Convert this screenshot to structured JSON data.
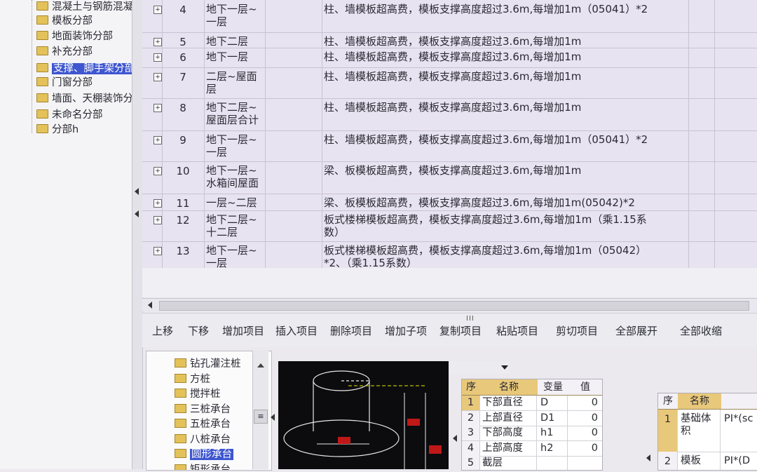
{
  "left_tree": {
    "items": [
      {
        "label": "混凝土与钢筋混凝",
        "selected": false
      },
      {
        "label": "模板分部",
        "selected": false
      },
      {
        "label": "地面装饰分部",
        "selected": false
      },
      {
        "label": "补充分部",
        "selected": false
      },
      {
        "label": "支撑、脚手架分部",
        "selected": true
      },
      {
        "label": "门窗分部",
        "selected": false
      },
      {
        "label": "墙面、天棚装饰分",
        "selected": false
      },
      {
        "label": "未命名分部",
        "selected": false
      },
      {
        "label": "分部h",
        "selected": false
      }
    ]
  },
  "grid": {
    "expand_glyph": "+",
    "rows": [
      {
        "no": "4",
        "position": [
          "地下一层~",
          "一层"
        ],
        "desc": [
          "柱、墙模板超高费，模板支撑高度超过3.6m,每增加1m（05041）*2"
        ]
      },
      {
        "no": "5",
        "position": [
          "地下二层"
        ],
        "desc": [
          "柱、墙模板超高费，模板支撑高度超过3.6m,每增加1m"
        ]
      },
      {
        "no": "6",
        "position": [
          "地下一层"
        ],
        "desc": [
          "柱、墙模板超高费，模板支撑高度超过3.6m,每增加1m"
        ]
      },
      {
        "no": "7",
        "position": [
          "二层~屋面",
          "层"
        ],
        "desc": [
          "柱、墙模板超高费，模板支撑高度超过3.6m,每增加1m"
        ]
      },
      {
        "no": "8",
        "position": [
          "地下二层~",
          "屋面层合计"
        ],
        "desc": [
          "柱、墙模板超高费，模板支撑高度超过3.6m,每增加1m"
        ]
      },
      {
        "no": "9",
        "position": [
          "地下一层~",
          "一层"
        ],
        "desc": [
          "柱、墙模板超高费，模板支撑高度超过3.6m,每增加1m（05041）*2"
        ]
      },
      {
        "no": "10",
        "position": [
          "地下一层~",
          "水箱间屋面"
        ],
        "desc": [
          "梁、板模板超高费，模板支撑高度超过3.6m,每增加1m"
        ]
      },
      {
        "no": "11",
        "position": [
          "一层~二层"
        ],
        "desc": [
          "梁、板模板超高费，模板支撑高度超过3.6m,每增加1m(05042)*2"
        ]
      },
      {
        "no": "12",
        "position": [
          "地下二层~",
          "十二层"
        ],
        "desc": [
          "板式楼梯模板超高费，模板支撑高度超过3.6m,每增加1m（乘1.15系",
          "数）"
        ]
      },
      {
        "no": "13",
        "position": [
          "地下一层~",
          "一层"
        ],
        "desc": [
          "板式楼梯模板超高费，模板支撑高度超过3.6m,每增加1m（05042）",
          "*2、（乘1.15系数）"
        ]
      }
    ]
  },
  "hscroll": {
    "grip": "III"
  },
  "toolbar": {
    "move_up": "上移",
    "move_down": "下移",
    "add_item": "增加项目",
    "insert_item": "插入项目",
    "delete_item": "删除项目",
    "add_child": "增加子项",
    "copy_item": "复制项目",
    "paste_item": "粘贴项目",
    "cut_item": "剪切项目",
    "expand_all": "全部展开",
    "collapse_all": "全部收缩"
  },
  "bottom_tree": {
    "items": [
      {
        "label": "钻孔灌注桩",
        "selected": false
      },
      {
        "label": "方桩",
        "selected": false
      },
      {
        "label": "搅拌桩",
        "selected": false
      },
      {
        "label": "三桩承台",
        "selected": false
      },
      {
        "label": "五桩承台",
        "selected": false
      },
      {
        "label": "八桩承台",
        "selected": false
      },
      {
        "label": "圆形承台",
        "selected": true
      },
      {
        "label": "矩形承台",
        "selected": false
      }
    ]
  },
  "params": {
    "headers": {
      "seq": "序",
      "name": "名称",
      "var": "变量",
      "val": "值"
    },
    "rows": [
      {
        "seq": "1",
        "name": "下部直径",
        "var": "D",
        "val": "0"
      },
      {
        "seq": "2",
        "name": "上部直径",
        "var": "D1",
        "val": "0"
      },
      {
        "seq": "3",
        "name": "下部高度",
        "var": "h1",
        "val": "0"
      },
      {
        "seq": "4",
        "name": "上部高度",
        "var": "h2",
        "val": "0"
      },
      {
        "seq": "5",
        "name": "截层",
        "var": "",
        "val": ""
      }
    ]
  },
  "formula": {
    "headers": {
      "seq": "序",
      "name": "名称"
    },
    "rows": [
      {
        "seq": "1",
        "name": [
          "基础体",
          "积"
        ],
        "formula": "PI*(sc"
      },
      {
        "seq": "2",
        "name": [
          "模板"
        ],
        "formula": "PI*(D"
      }
    ]
  }
}
